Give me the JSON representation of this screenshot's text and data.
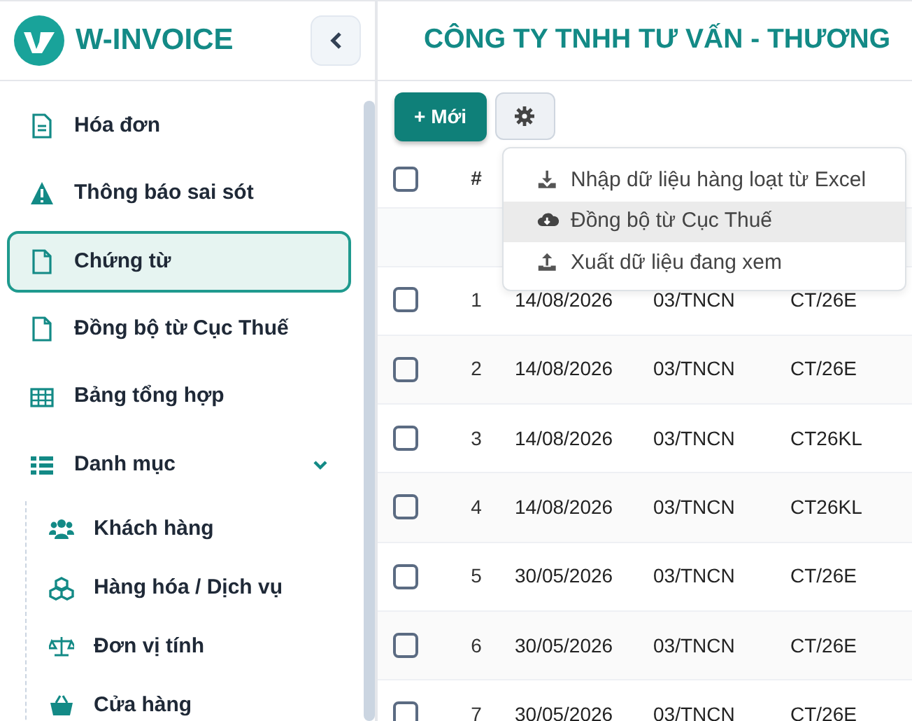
{
  "brand": {
    "name": "W-INVOICE"
  },
  "sidebar": {
    "items": [
      {
        "label": "Hóa đơn",
        "selected": false
      },
      {
        "label": "Thông báo sai sót",
        "selected": false
      },
      {
        "label": "Chứng từ",
        "selected": true
      },
      {
        "label": "Đồng bộ từ Cục Thuế",
        "selected": false
      },
      {
        "label": "Bảng tổng hợp",
        "selected": false
      },
      {
        "label": "Danh mục",
        "selected": false,
        "expanded": true,
        "children": [
          {
            "label": "Khách hàng",
            "selected": false
          },
          {
            "label": "Hàng hóa / Dịch vụ",
            "selected": false
          },
          {
            "label": "Đơn vị tính",
            "selected": false
          },
          {
            "label": "Cửa hàng",
            "selected": false
          }
        ]
      }
    ]
  },
  "header": {
    "title": "CÔNG TY TNHH TƯ VẤN - THƯƠNG"
  },
  "toolbar": {
    "new_button": {
      "label": "+ Mới"
    },
    "settings_menu": {
      "expanded": true,
      "items": [
        {
          "label": "Nhập dữ liệu hàng loạt từ Excel",
          "selected": false
        },
        {
          "label": "Đồng bộ từ Cục Thuế",
          "selected": true
        },
        {
          "label": "Xuất dữ liệu đang xem",
          "selected": false
        }
      ]
    }
  },
  "table": {
    "select_all_checked": false,
    "columns": [
      "#"
    ],
    "rows": [
      {
        "checked": false,
        "cells": [
          "1",
          "14/08/2026",
          "03/TNCN",
          "CT/26E"
        ]
      },
      {
        "checked": false,
        "cells": [
          "2",
          "14/08/2026",
          "03/TNCN",
          "CT/26E"
        ]
      },
      {
        "checked": false,
        "cells": [
          "3",
          "14/08/2026",
          "03/TNCN",
          "CT26KL"
        ]
      },
      {
        "checked": false,
        "cells": [
          "4",
          "14/08/2026",
          "03/TNCN",
          "CT26KL"
        ]
      },
      {
        "checked": false,
        "cells": [
          "5",
          "30/05/2026",
          "03/TNCN",
          "CT/26E"
        ]
      },
      {
        "checked": false,
        "cells": [
          "6",
          "30/05/2026",
          "03/TNCN",
          "CT/26E"
        ]
      },
      {
        "checked": false,
        "cells": [
          "7",
          "30/05/2026",
          "03/TNCN",
          "CT/26E"
        ]
      }
    ]
  }
}
